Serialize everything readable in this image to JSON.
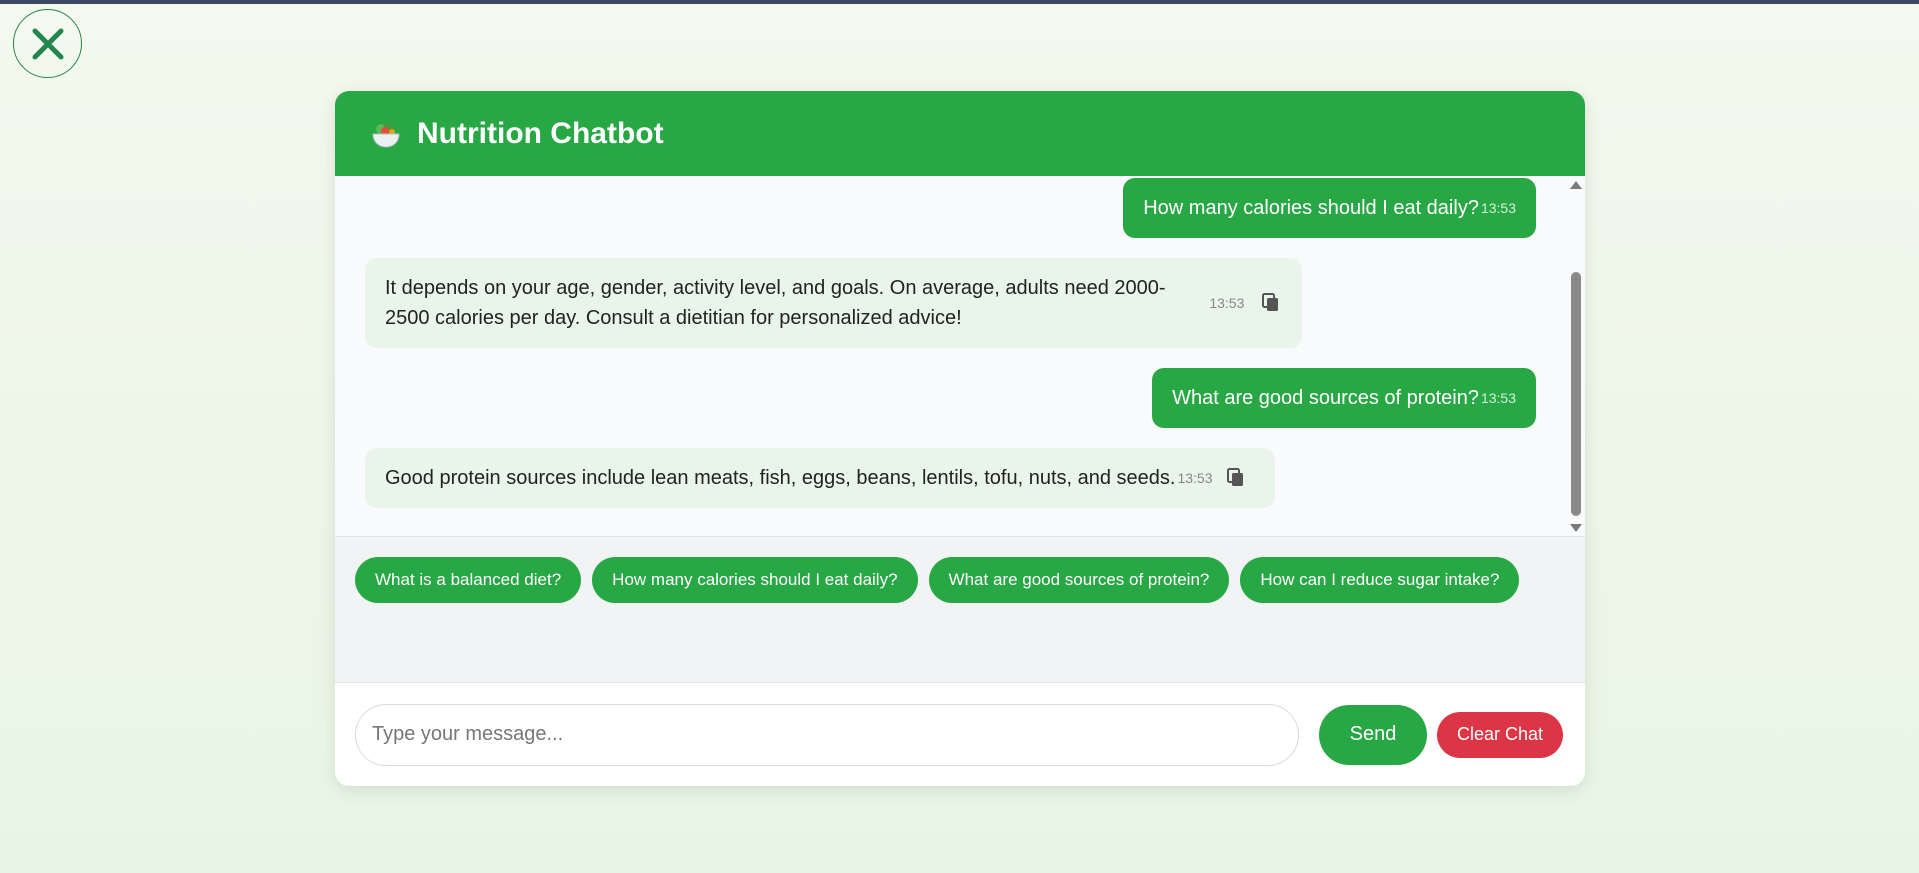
{
  "window": {
    "close_icon": "close-x-icon"
  },
  "header": {
    "icon": "salad-bowl-icon",
    "title": "Nutrition Chatbot"
  },
  "messages": [
    {
      "role": "user",
      "text": "How many calories should I eat daily?",
      "time": "13:53"
    },
    {
      "role": "bot",
      "text": "It depends on your age, gender, activity level, and goals. On average, adults need 2000-2500 calories per day. Consult a dietitian for personalized advice!",
      "time": "13:53",
      "copy_icon": "copy-icon"
    },
    {
      "role": "user",
      "text": "What are good sources of protein?",
      "time": "13:53"
    },
    {
      "role": "bot",
      "text": "Good protein sources include lean meats, fish, eggs, beans, lentils, tofu, nuts, and seeds.",
      "time": "13:53",
      "copy_icon": "copy-icon"
    }
  ],
  "suggestions": [
    "What is a balanced diet?",
    "How many calories should I eat daily?",
    "What are good sources of protein?",
    "How can I reduce sugar intake?"
  ],
  "input": {
    "placeholder": "Type your message...",
    "value": ""
  },
  "buttons": {
    "send": "Send",
    "clear": "Clear Chat"
  },
  "colors": {
    "primary": "#28a745",
    "danger": "#dc3545",
    "bot_bubble": "#e9f5ea",
    "close_icon": "#23864d"
  }
}
